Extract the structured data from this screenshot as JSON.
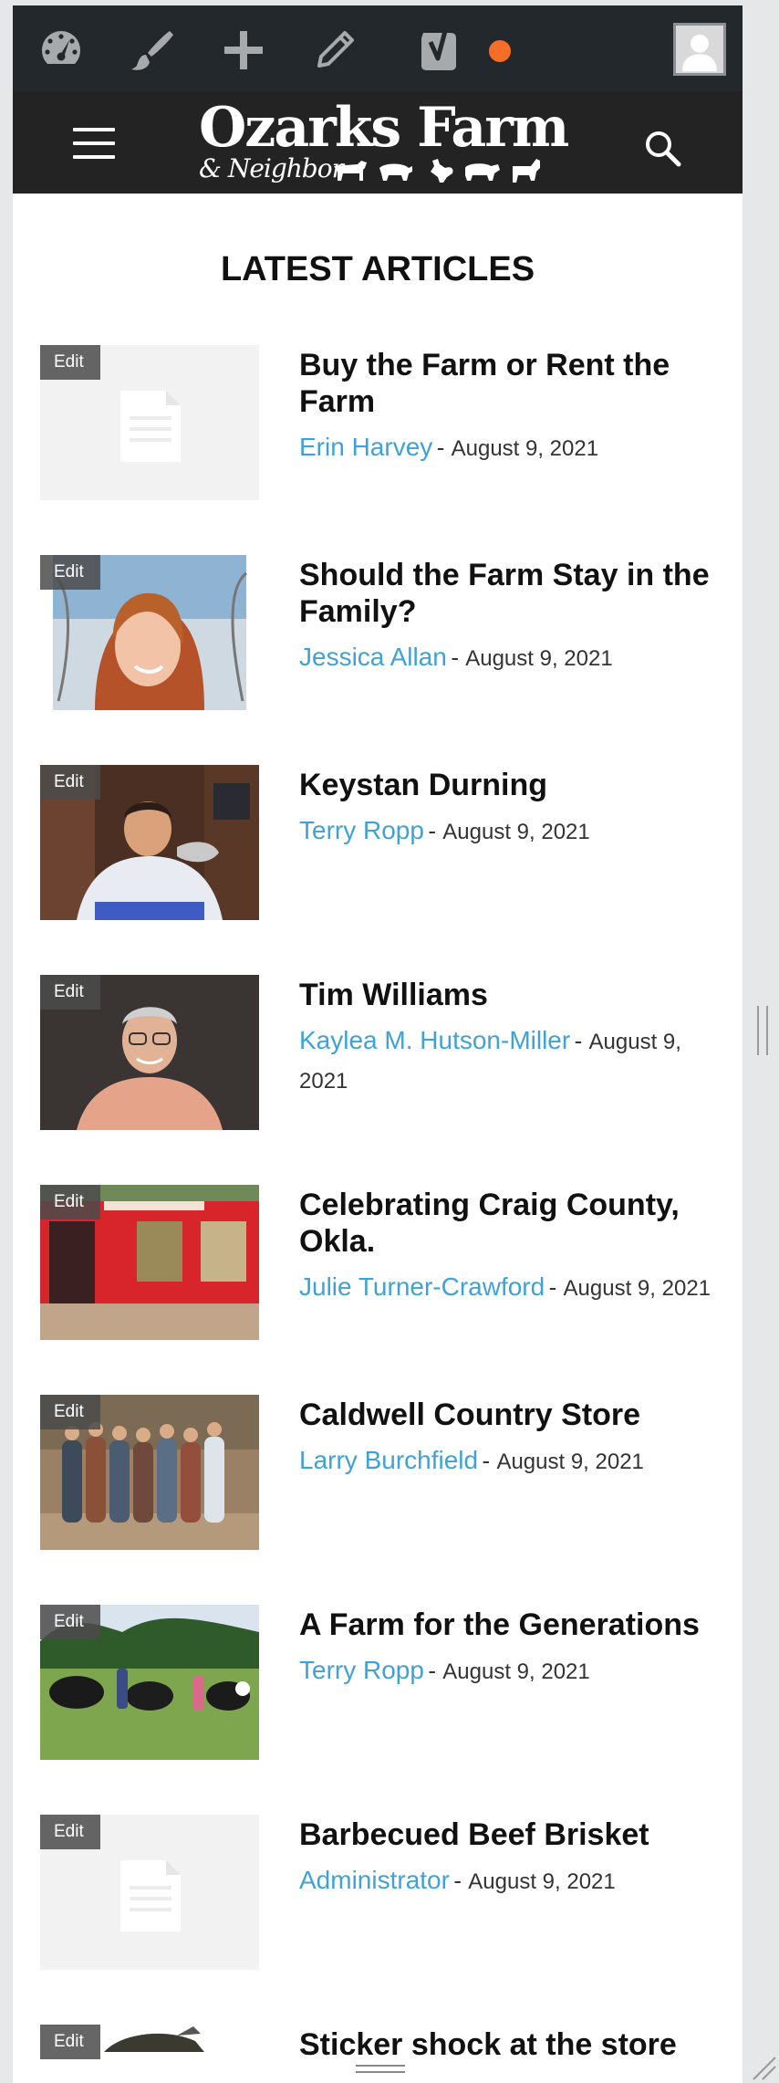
{
  "admin_bar": {
    "icons": [
      "dashboard-icon",
      "customize-brush-icon",
      "new-content-plus-icon",
      "edit-pencil-icon",
      "yoast-seo-icon"
    ],
    "notification_color": "#f56e28",
    "avatar": "user-avatar-icon"
  },
  "header": {
    "logo_title": "Ozarks Farm",
    "logo_subtitle": "& Neighbor",
    "logo_icons": [
      "cow-icon",
      "pig-icon",
      "chicken-icon",
      "sheep-icon",
      "goat-icon"
    ],
    "menu_icon": "hamburger-menu-icon",
    "search_icon": "search-icon"
  },
  "section_title": "LATEST ARTICLES",
  "edit_label": "Edit",
  "separator": "-",
  "articles": [
    {
      "title": "Buy the Farm or Rent the Farm",
      "author": "Erin Harvey",
      "date": "August 9, 2021",
      "image": "placeholder"
    },
    {
      "title": "Should the Farm Stay in the Family?",
      "author": "Jessica Allan",
      "date": "August 9, 2021",
      "image": "portrait-woman-barbed-wire"
    },
    {
      "title": "Keystan Durning",
      "author": "Terry Ropp",
      "date": "August 9, 2021",
      "image": "football-player-locker-room"
    },
    {
      "title": "Tim Williams",
      "author": "Kaylea M. Hutson-Miller",
      "date": "August 9, 2021",
      "image": "portrait-man-glasses"
    },
    {
      "title": "Celebrating Craig County, Okla.",
      "author": "Julie Turner-Crawford",
      "date": "August 9, 2021",
      "image": "red-building-murals"
    },
    {
      "title": "Caldwell Country Store",
      "author": "Larry Burchfield",
      "date": "August 9, 2021",
      "image": "family-group-photo"
    },
    {
      "title": "A Farm for the Generations",
      "author": "Terry Ropp",
      "date": "August 9, 2021",
      "image": "cattle-in-pasture"
    },
    {
      "title": "Barbecued Beef Brisket",
      "author": "Administrator",
      "date": "August 9, 2021",
      "image": "placeholder"
    },
    {
      "title": "Sticker shock at the store",
      "author": "",
      "date": "",
      "image": "cattle-partial"
    }
  ],
  "colors": {
    "admin_bar_bg": "#23282d",
    "header_bg": "#232323",
    "link": "#3ea2d9",
    "accent_dot": "#f56e28"
  }
}
